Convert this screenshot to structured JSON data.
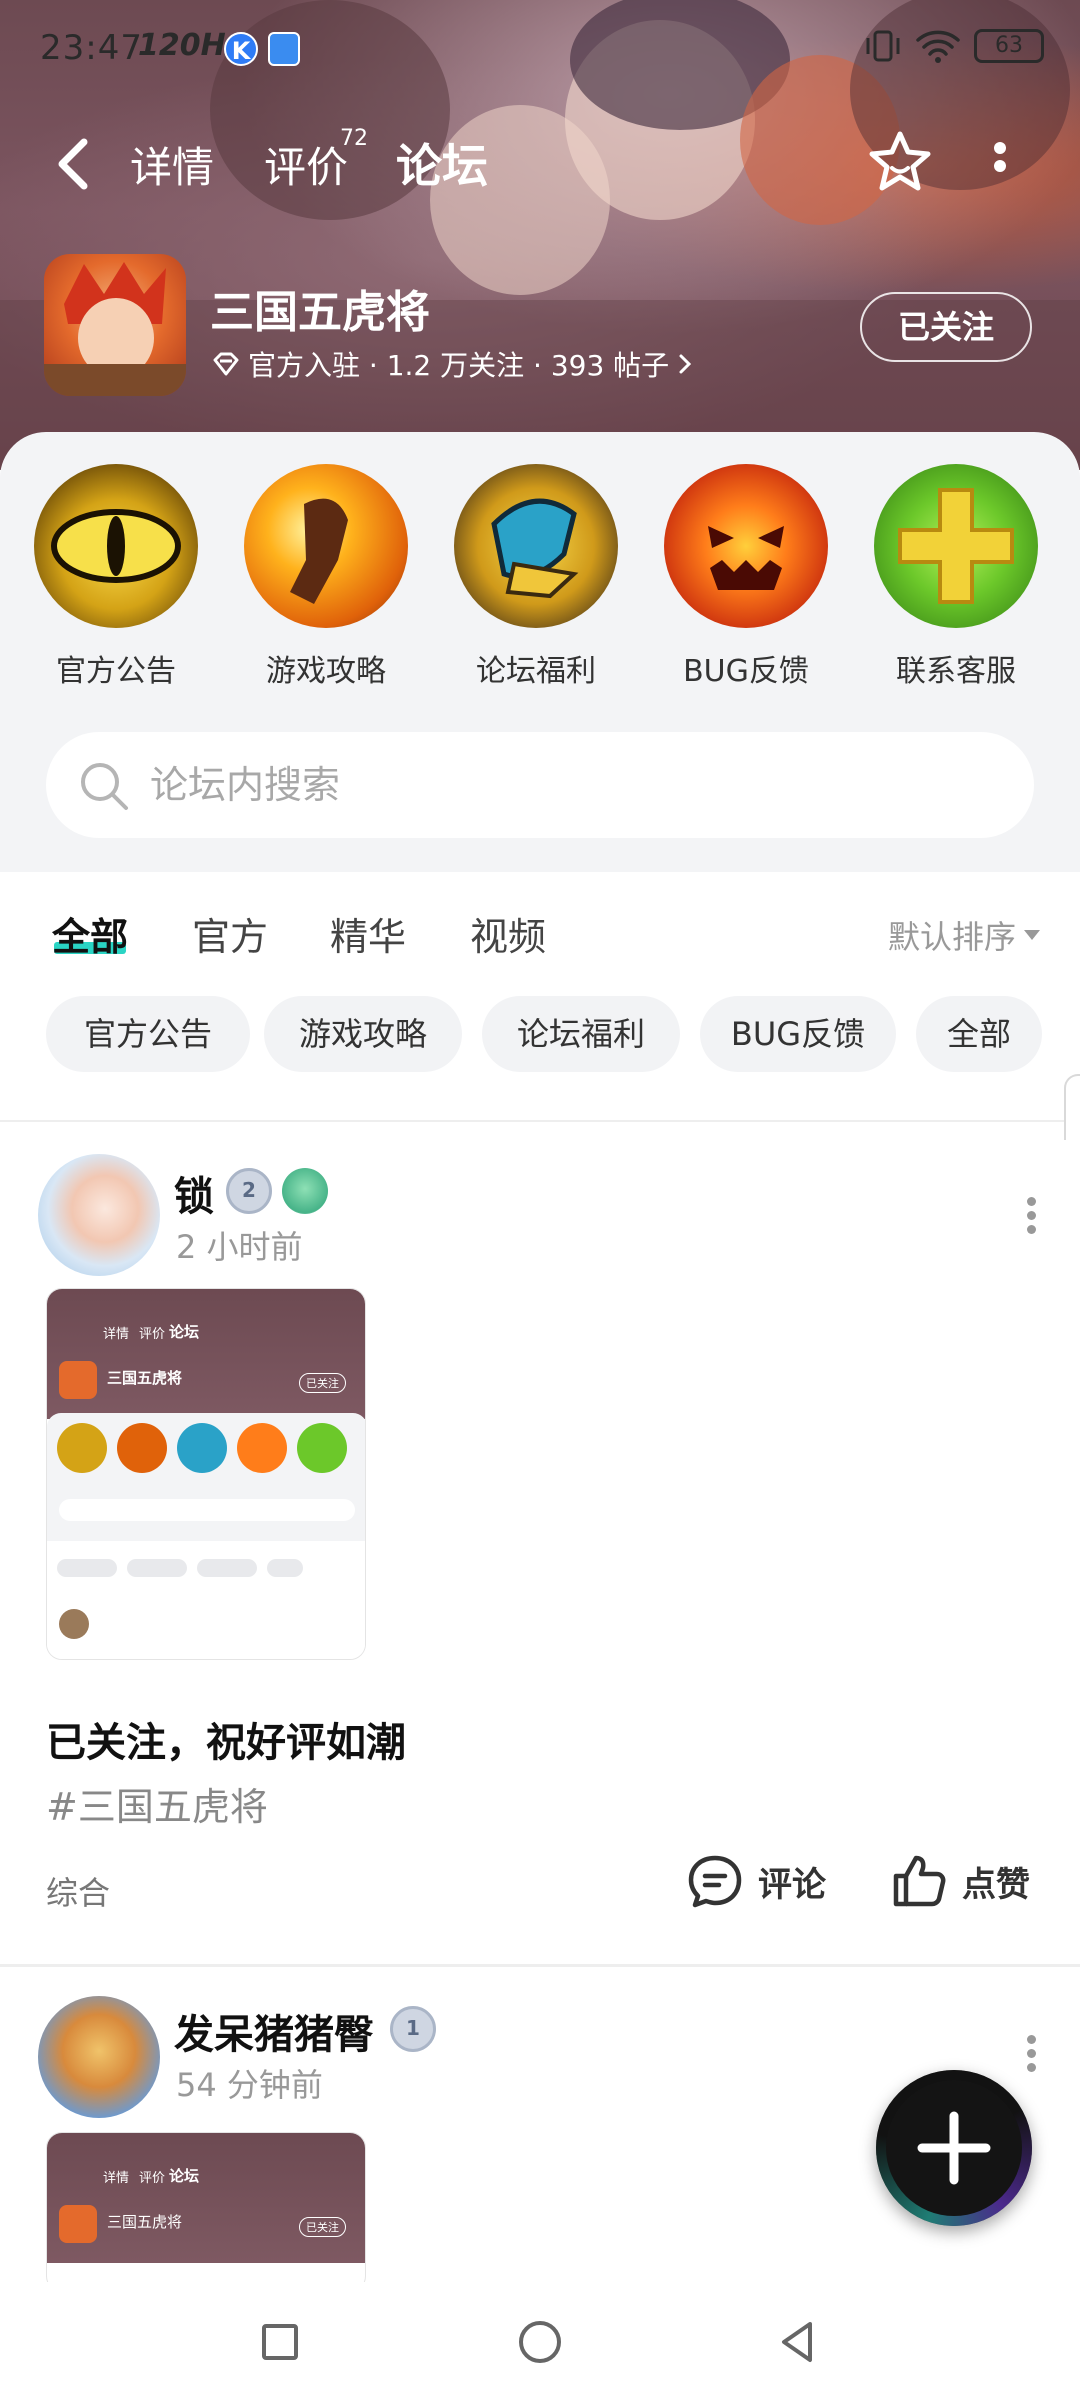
{
  "status_bar": {
    "time": "23:47",
    "refresh_rate": "120Hz",
    "battery": "63"
  },
  "nav": {
    "tabs": [
      "详情",
      "评价",
      "论坛"
    ],
    "review_count": "72",
    "active_tab": "论坛"
  },
  "game": {
    "title": "三国五虎将",
    "meta": "官方入驻 · 1.2 万关注 · 393 帖子",
    "follow_label": "已关注"
  },
  "categories": [
    {
      "label": "官方公告",
      "icon": "cat-eye-icon"
    },
    {
      "label": "游戏攻略",
      "icon": "fist-icon"
    },
    {
      "label": "论坛福利",
      "icon": "gauntlet-icon"
    },
    {
      "label": "BUG反馈",
      "icon": "pumpkin-icon"
    },
    {
      "label": "联系客服",
      "icon": "green-cross-icon"
    }
  ],
  "search": {
    "placeholder": "论坛内搜索"
  },
  "feed_tabs": [
    "全部",
    "官方",
    "精华",
    "视频"
  ],
  "sort_label": "默认排序",
  "chips": [
    "官方公告",
    "游戏攻略",
    "论坛福利",
    "BUG反馈",
    "全部"
  ],
  "posts": [
    {
      "user": "锁",
      "level": "2",
      "time": "2 小时前",
      "title": "已关注，祝好评如潮",
      "tag": "#三国五虎将",
      "category": "综合",
      "comment_label": "评论",
      "like_label": "点赞"
    },
    {
      "user": "发呆猪猪臀",
      "level": "1",
      "time": "54 分钟前"
    }
  ],
  "colors": {
    "accent": "#2ad4c4",
    "banner": "#7c5560",
    "panel": "#f3f4f6"
  }
}
